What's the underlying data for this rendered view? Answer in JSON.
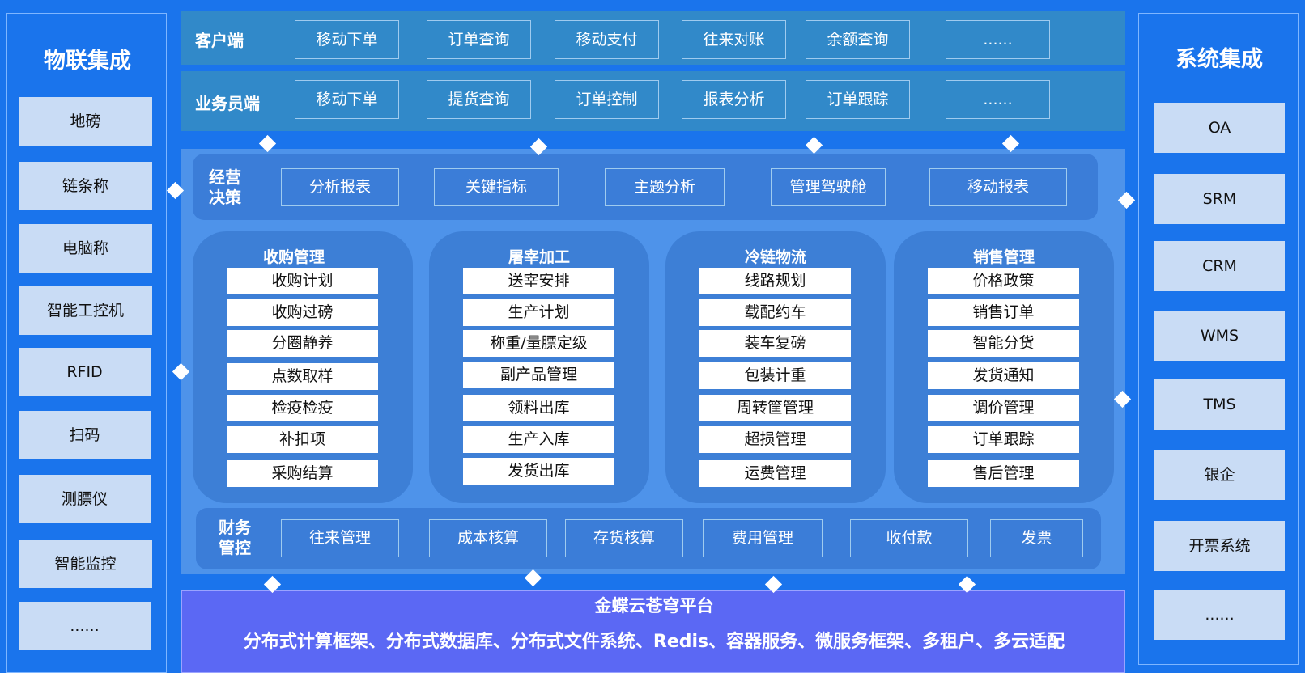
{
  "iot": {
    "title": "物联集成",
    "items": [
      "地磅",
      "链条称",
      "电脑称",
      "智能工控机",
      "RFID",
      "扫码",
      "测膘仪",
      "智能监控",
      "......"
    ]
  },
  "system": {
    "title": "系统集成",
    "items": [
      "OA",
      "SRM",
      "CRM",
      "WMS",
      "TMS",
      "银企",
      "开票系统",
      "......"
    ]
  },
  "client": {
    "label": "客户端",
    "items": [
      "移动下单",
      "订单查询",
      "移动支付",
      "往来对账",
      "余额查询",
      "......"
    ]
  },
  "sales_rep": {
    "label": "业务员端",
    "items": [
      "移动下单",
      "提货查询",
      "订单控制",
      "报表分析",
      "订单跟踪",
      "......"
    ]
  },
  "decision": {
    "label_line1": "经营",
    "label_line2": "决策",
    "items": [
      "分析报表",
      "关键指标",
      "主题分析",
      "管理驾驶舱",
      "移动报表"
    ]
  },
  "modules": [
    {
      "title": "收购管理",
      "items": [
        "收购计划",
        "收购过磅",
        "分圈静养",
        "点数取样",
        "检疫检疫",
        "补扣项",
        "采购结算"
      ]
    },
    {
      "title": "屠宰加工",
      "items": [
        "送宰安排",
        "生产计划",
        "称重/量膘定级",
        "副产品管理",
        "领料出库",
        "生产入库",
        "发货出库"
      ]
    },
    {
      "title": "冷链物流",
      "items": [
        "线路规划",
        "载配约车",
        "装车复磅",
        "包装计重",
        "周转筐管理",
        "超损管理",
        "运费管理"
      ]
    },
    {
      "title": "销售管理",
      "items": [
        "价格政策",
        "销售订单",
        "智能分货",
        "发货通知",
        "调价管理",
        "订单跟踪",
        "售后管理"
      ]
    }
  ],
  "finance": {
    "label_line1": "财务",
    "label_line2": "管控",
    "items": [
      "往来管理",
      "成本核算",
      "存货核算",
      "费用管理",
      "收付款",
      "发票"
    ]
  },
  "platform": {
    "title": "金蝶云苍穹平台",
    "description": "分布式计算框架、分布式数据库、分布式文件系统、Redis、容器服务、微服务框架、多租户、多云适配"
  },
  "colors": {
    "background": "#1a74ec",
    "band": "#3189c9",
    "panel": "#4e93ea",
    "module": "#3d7fd6",
    "platform": "#5b68f4",
    "side_box": "#c9dcf5"
  }
}
